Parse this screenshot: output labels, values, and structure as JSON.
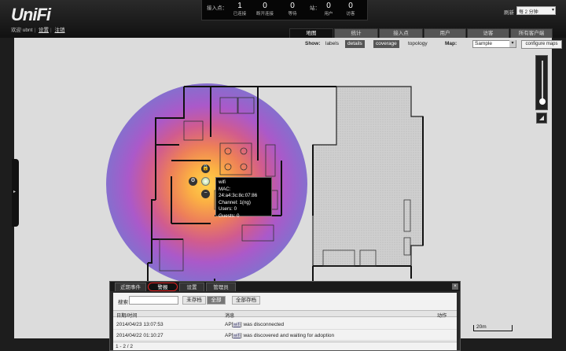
{
  "app": {
    "logo": "UniFi"
  },
  "user": {
    "welcome": "欢迎 ubnt",
    "settings_link": "设置",
    "logout_link": "注销"
  },
  "stats": {
    "label_ap": "接入点：",
    "label_station": "站：",
    "ap_connected": {
      "value": "1",
      "caption": "已连接"
    },
    "ap_disconnected": {
      "value": "0",
      "caption": "断开连接"
    },
    "ap_pending": {
      "value": "0",
      "caption": "等待"
    },
    "sta_user": {
      "value": "0",
      "caption": "用户"
    },
    "sta_guest": {
      "value": "0",
      "caption": "访客"
    }
  },
  "refresh": {
    "label": "刷新",
    "value": "每 2 分钟"
  },
  "tabs": [
    {
      "label": "地图"
    },
    {
      "label": "统计"
    },
    {
      "label": "接入点"
    },
    {
      "label": "用户"
    },
    {
      "label": "访客"
    },
    {
      "label": "所有客户端"
    }
  ],
  "toolbar": {
    "show_label": "Show:",
    "labels": "labels",
    "details": "details",
    "coverage": "coverage",
    "topology": "topology",
    "map_label": "Map:",
    "map_value": "Sample",
    "configure_maps": "configure maps"
  },
  "tooltip": {
    "name": "wifi",
    "mac": "MAC: 24:a4:3c:8c:07:86",
    "channel": "Channel: 1(ng)",
    "users": "Users: 0",
    "guests": "Guests: 0"
  },
  "scale_label": "20m",
  "panel": {
    "tabs": [
      {
        "label": "近期事件"
      },
      {
        "label": "警报"
      },
      {
        "label": "设置"
      },
      {
        "label": "管理员"
      }
    ],
    "close": "×",
    "search_label": "搜索",
    "search_value": "",
    "filter_unarchived": "未存档",
    "filter_all": "全部",
    "archive_all": "全部存档",
    "columns": {
      "time": "日期/时间",
      "message": "消息",
      "action": "动作"
    },
    "rows": [
      {
        "time": "2014/04/23 13:07:53",
        "msg_prefix": "AP[",
        "msg_link": "wifi",
        "msg_suffix": "] was disconnected"
      },
      {
        "time": "2014/04/22 01:10:27",
        "msg_prefix": "AP[",
        "msg_link": "wifi",
        "msg_suffix": "] was discovered and waiting for adoption"
      }
    ],
    "pager": "1 - 2 / 2"
  }
}
